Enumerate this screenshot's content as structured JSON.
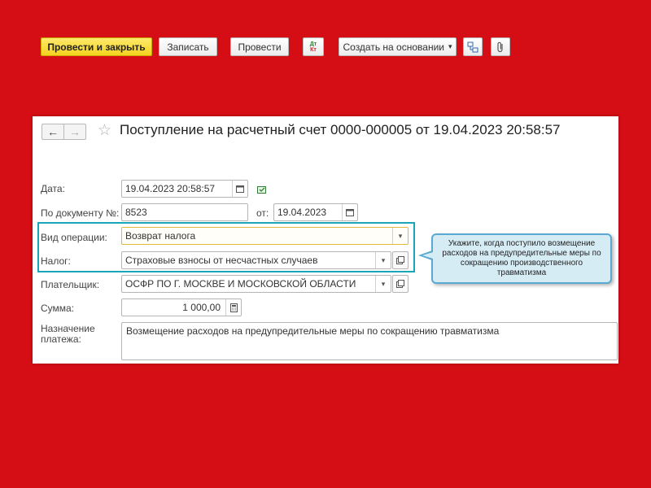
{
  "window": {
    "title": "Поступление на расчетный счет 0000-000005 от 19.04.2023 20:58:57",
    "back_icon": "←",
    "forward_icon": "→",
    "favorite_icon": "☆"
  },
  "toolbar": {
    "post_close_label": "Провести и закрыть",
    "save_label": "Записать",
    "post_label": "Провести",
    "dt_kt_label_top": "Дт",
    "dt_kt_label_bottom": "Кт",
    "create_based_label": "Создать на основании",
    "dropdown_icon": "▾"
  },
  "form": {
    "date": {
      "label": "Дата:",
      "value": "19.04.2023 20:58:57"
    },
    "doc_number": {
      "label": "По документу №:",
      "value": "8523",
      "from_label": "от:",
      "from_value": "19.04.2023"
    },
    "operation": {
      "label": "Вид операции:",
      "value": "Возврат налога"
    },
    "tax": {
      "label": "Налог:",
      "value": "Страховые взносы от несчастных случаев"
    },
    "payer": {
      "label": "Плательщик:",
      "value": "ОСФР ПО Г. МОСКВЕ И МОСКОВСКОЙ ОБЛАСТИ"
    },
    "amount": {
      "label": "Сумма:",
      "value": "1 000,00"
    },
    "purpose": {
      "label_line1": "Назначение",
      "label_line2": "платежа:",
      "value": "Возмещение расходов на предупредительные меры по сокращению травматизма"
    }
  },
  "callout": {
    "text": "Укажите, когда поступило возмещение расходов на предупредительные меры по сокращению производственного травматизма"
  },
  "colors": {
    "background": "#d50d15",
    "primary_button": "#f4d21e",
    "highlight_border": "#19a6b8",
    "callout_fill": "#d6ecf5"
  }
}
